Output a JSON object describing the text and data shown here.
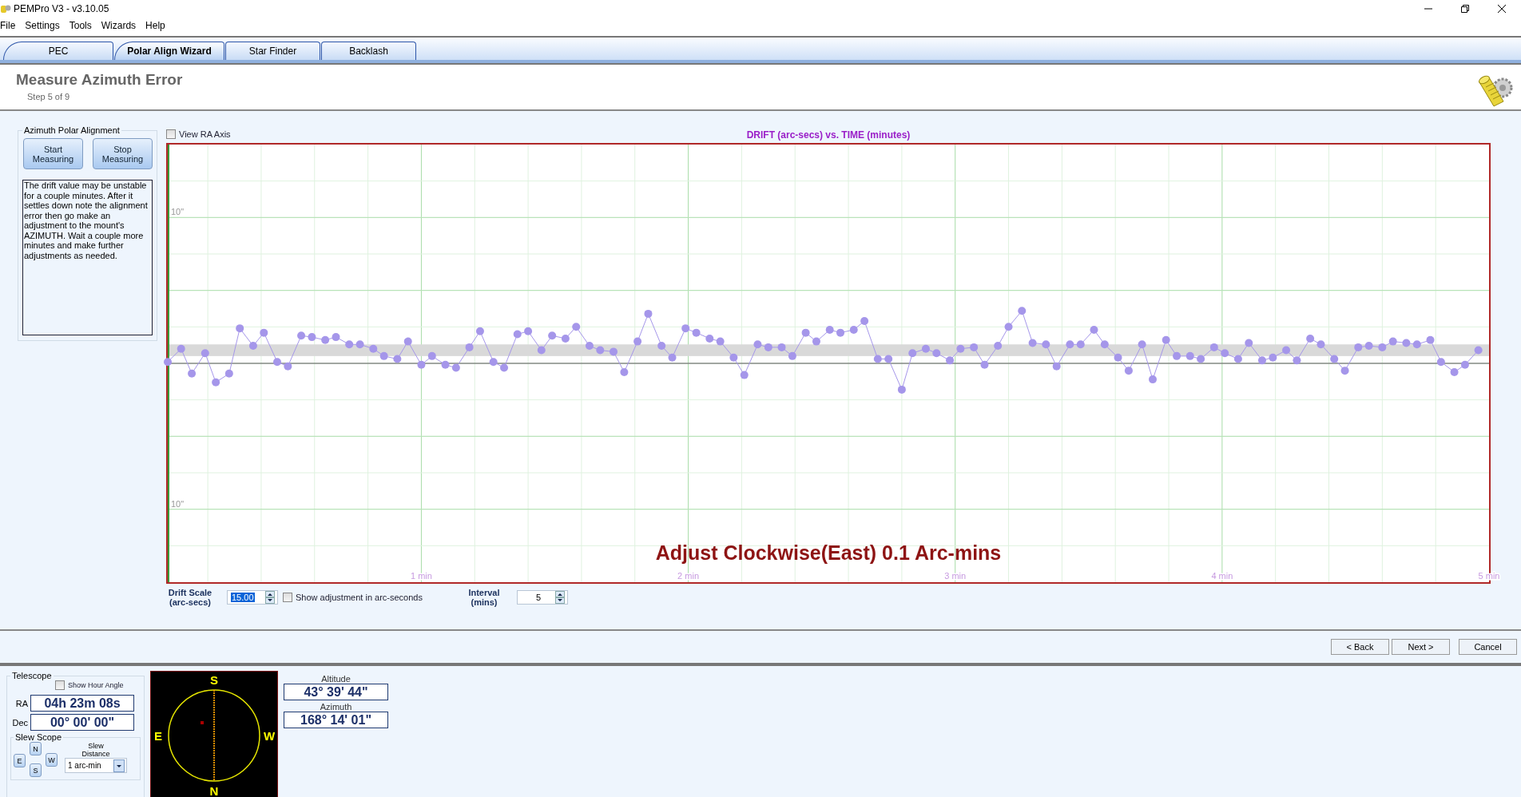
{
  "window": {
    "title": "PEMPro V3 - v3.10.05"
  },
  "menu": [
    "File",
    "Settings",
    "Tools",
    "Wizards",
    "Help"
  ],
  "tabs": [
    {
      "label": "PEC",
      "selected": false
    },
    {
      "label": "Polar Align Wizard",
      "selected": true
    },
    {
      "label": "Star Finder",
      "selected": false
    },
    {
      "label": "Backlash",
      "selected": false
    }
  ],
  "wizard": {
    "title": "Measure Azimuth Error",
    "step": "Step 5 of 9",
    "azimuth_group": {
      "title": "Azimuth Polar Alignment",
      "buttons": [
        "Start Measuring",
        "Stop Measuring"
      ],
      "instructions": "The drift value may be unstable for a couple minutes. After it settles down note the alignment error then go make an adjustment to the mount's AZIMUTH. Wait a couple more minutes and make further adjustments as needed."
    },
    "view_ra_axis": {
      "label": "View RA Axis",
      "checked": false
    },
    "chart": {
      "message": "Adjust Clockwise(East) 0.1 Arc-mins",
      "chart_data": {
        "type": "line",
        "title": "DRIFT (arc-secs) vs. TIME (minutes)",
        "xlim": [
          0.05,
          5
        ],
        "ylim": [
          -15,
          15
        ],
        "xticks": [
          {
            "value": 1,
            "label": "1 min"
          },
          {
            "value": 2,
            "label": "2 min"
          },
          {
            "value": 3,
            "label": "3 min"
          },
          {
            "value": 4,
            "label": "4 min"
          },
          {
            "value": 5,
            "label": "5 min"
          }
        ],
        "yticks": [
          {
            "value": 10,
            "label": "10\""
          },
          {
            "value": -10,
            "label": "10\""
          }
        ],
        "grid": true,
        "bands": [
          {
            "axis": "y",
            "from": 0.5,
            "to": 1.3
          }
        ],
        "x": [
          0.05,
          0.1,
          0.14,
          0.19,
          0.23,
          0.28,
          0.32,
          0.37,
          0.41,
          0.46,
          0.5,
          0.55,
          0.59,
          0.64,
          0.68,
          0.73,
          0.77,
          0.82,
          0.86,
          0.91,
          0.95,
          1.0,
          1.04,
          1.09,
          1.13,
          1.18,
          1.22,
          1.27,
          1.31,
          1.36,
          1.4,
          1.45,
          1.49,
          1.54,
          1.58,
          1.63,
          1.67,
          1.72,
          1.76,
          1.81,
          1.85,
          1.9,
          1.94,
          1.99,
          2.03,
          2.08,
          2.12,
          2.17,
          2.21,
          2.26,
          2.3,
          2.35,
          2.39,
          2.44,
          2.48,
          2.53,
          2.57,
          2.62,
          2.66,
          2.71,
          2.75,
          2.8,
          2.84,
          2.89,
          2.93,
          2.98,
          3.02,
          3.07,
          3.11,
          3.16,
          3.2,
          3.25,
          3.29,
          3.34,
          3.38,
          3.43,
          3.47,
          3.52,
          3.56,
          3.61,
          3.65,
          3.7,
          3.74,
          3.79,
          3.83,
          3.88,
          3.92,
          3.97,
          4.01,
          4.06,
          4.1,
          4.15,
          4.19,
          4.24,
          4.28,
          4.33,
          4.37,
          4.42,
          4.46,
          4.51,
          4.55,
          4.6,
          4.64,
          4.69,
          4.73,
          4.78,
          4.82,
          4.87,
          4.91,
          4.96
        ],
        "series": [
          {
            "color": "#a596ea",
            "marker": "circle",
            "values": [
              0.1,
              1.0,
              -0.7,
              0.7,
              -1.3,
              -0.7,
              2.4,
              1.2,
              2.1,
              0.1,
              -0.2,
              1.9,
              1.8,
              1.6,
              1.8,
              1.3,
              1.3,
              1.0,
              0.5,
              0.3,
              1.5,
              -0.1,
              0.5,
              -0.1,
              -0.3,
              1.1,
              2.2,
              0.1,
              -0.3,
              2.0,
              2.2,
              0.9,
              1.9,
              1.7,
              2.5,
              1.2,
              0.9,
              0.8,
              -0.6,
              1.5,
              3.4,
              1.2,
              0.4,
              2.4,
              2.1,
              1.7,
              1.5,
              0.4,
              -0.8,
              1.3,
              1.1,
              1.1,
              0.5,
              2.1,
              1.5,
              2.3,
              2.1,
              2.3,
              2.9,
              0.3,
              0.3,
              -1.8,
              0.7,
              1.0,
              0.7,
              0.2,
              1.0,
              1.1,
              -0.1,
              1.2,
              2.5,
              3.6,
              1.4,
              1.3,
              -0.2,
              1.3,
              1.3,
              2.3,
              1.3,
              0.4,
              -0.5,
              1.3,
              -1.1,
              1.6,
              0.5,
              0.5,
              0.3,
              1.1,
              0.7,
              0.3,
              1.4,
              0.2,
              0.4,
              0.9,
              0.2,
              1.7,
              1.3,
              0.3,
              -0.5,
              1.1,
              1.2,
              1.1,
              1.5,
              1.4,
              1.3,
              1.6,
              0.1,
              -0.6,
              -0.1,
              0.9
            ]
          }
        ]
      }
    },
    "drift_scale": {
      "label": "Drift Scale\n(arc-secs)",
      "value": "15.00",
      "text_selected": true
    },
    "show_adjustment": {
      "label": "Show adjustment in arc-seconds",
      "checked": false
    },
    "interval": {
      "label": "Interval\n(mins)",
      "value": "5"
    },
    "nav_buttons": [
      "< Back",
      "Next >",
      "Cancel"
    ]
  },
  "telescope": {
    "title": "Telescope",
    "show_hour_angle": {
      "label": "Show Hour Angle",
      "checked": false
    },
    "coords": [
      {
        "label": "RA",
        "value": "04h 23m 08s"
      },
      {
        "label": "Dec",
        "value": "00° 00' 00\""
      }
    ],
    "slew": {
      "title": "Slew Scope",
      "directions": [
        "N",
        "E",
        "W",
        "S"
      ],
      "distance_label": "Slew Distance",
      "distance": "1 arc-min"
    }
  },
  "compass": {
    "north": "N",
    "south": "S",
    "east": "E",
    "west": "W"
  },
  "altaz": [
    {
      "label": "Altitude",
      "value": "43° 39' 44\""
    },
    {
      "label": "Azimuth",
      "value": "168° 14' 01\""
    }
  ]
}
